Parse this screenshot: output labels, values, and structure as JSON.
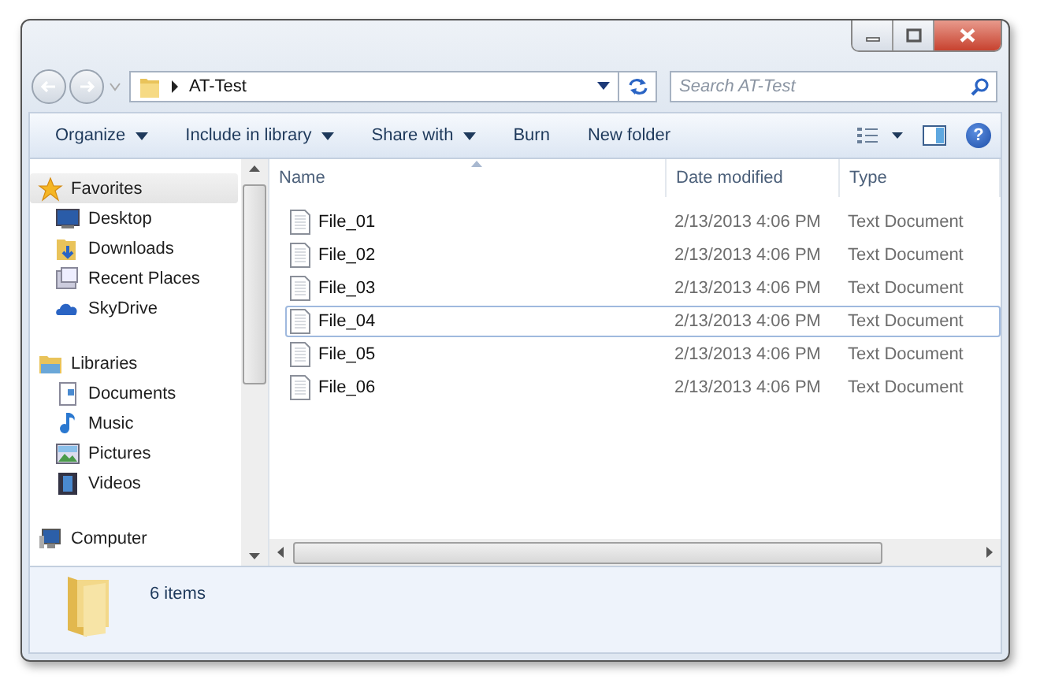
{
  "address": {
    "path": "AT-Test"
  },
  "search": {
    "placeholder": "Search AT-Test"
  },
  "toolbar": {
    "items": [
      {
        "label": "Organize",
        "dropdown": true
      },
      {
        "label": "Include in library",
        "dropdown": true
      },
      {
        "label": "Share with",
        "dropdown": true
      },
      {
        "label": "Burn",
        "dropdown": false
      },
      {
        "label": "New folder",
        "dropdown": false
      }
    ],
    "help": "?"
  },
  "sidebar": {
    "groups": [
      {
        "label": "Favorites",
        "selected": true,
        "children": [
          {
            "label": "Desktop",
            "selected": false
          },
          {
            "label": "Downloads",
            "selected": false
          },
          {
            "label": "Recent Places",
            "selected": false
          },
          {
            "label": "SkyDrive",
            "selected": false
          }
        ]
      },
      {
        "label": "Libraries",
        "selected": false,
        "children": [
          {
            "label": "Documents",
            "selected": false
          },
          {
            "label": "Music",
            "selected": false
          },
          {
            "label": "Pictures",
            "selected": false
          },
          {
            "label": "Videos",
            "selected": false
          }
        ]
      },
      {
        "label": "Computer",
        "selected": false
      }
    ]
  },
  "table": {
    "columns": [
      "Name",
      "Date modified",
      "Type"
    ],
    "rows": [
      {
        "name": "File_01",
        "date": "2/13/2013 4:06 PM",
        "type": "Text Document",
        "focused": false
      },
      {
        "name": "File_02",
        "date": "2/13/2013 4:06 PM",
        "type": "Text Document",
        "focused": false
      },
      {
        "name": "File_03",
        "date": "2/13/2013 4:06 PM",
        "type": "Text Document",
        "focused": false
      },
      {
        "name": "File_04",
        "date": "2/13/2013 4:06 PM",
        "type": "Text Document",
        "focused": true
      },
      {
        "name": "File_05",
        "date": "2/13/2013 4:06 PM",
        "type": "Text Document",
        "focused": false
      },
      {
        "name": "File_06",
        "date": "2/13/2013 4:06 PM",
        "type": "Text Document",
        "focused": false
      }
    ]
  },
  "status_bar": {
    "count": "6 items"
  }
}
